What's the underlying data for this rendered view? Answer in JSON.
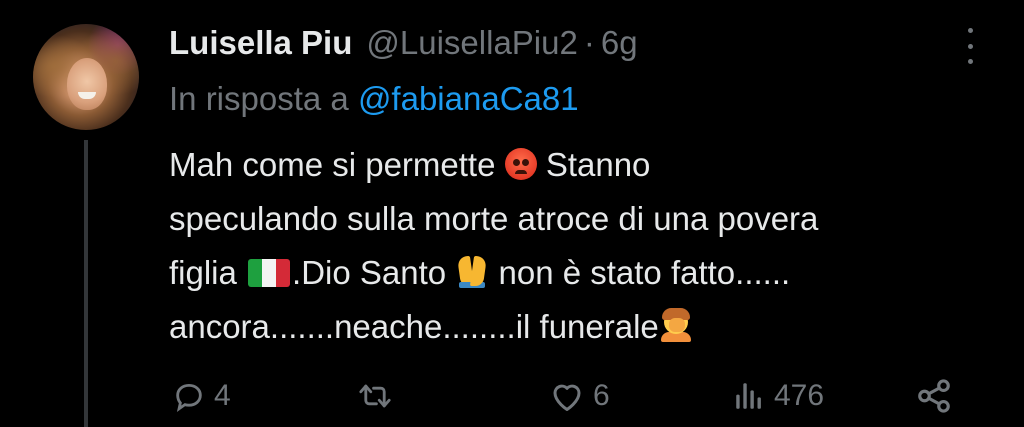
{
  "tweet": {
    "author_name": "Luisella Piu",
    "handle": "@LuisellaPiu2",
    "separator": "·",
    "time": "6g",
    "reply_label": "In risposta a",
    "reply_mention": "@fabianaCa81",
    "body": {
      "line1_a": "Mah come si permette",
      "line1_b": "Stanno",
      "line2": "speculando sulla morte atroce di una povera",
      "line3_a": "figlia",
      "line3_b": ".Dio Santo",
      "line3_c": "non è stato fatto......",
      "line4": "ancora.......neache........il funerale"
    },
    "emoji": {
      "angry": "angry-face-emoji",
      "flag": "italy-flag-emoji",
      "pray": "folded-hands-emoji",
      "facepalm": "person-facepalming-emoji"
    }
  },
  "actions": {
    "replies": "4",
    "retweets": "",
    "likes": "6",
    "views": "476"
  },
  "colors": {
    "background": "#000000",
    "text": "#e7e9ea",
    "muted": "#71767b",
    "link": "#1d9bf0",
    "thread_line": "#333639"
  }
}
